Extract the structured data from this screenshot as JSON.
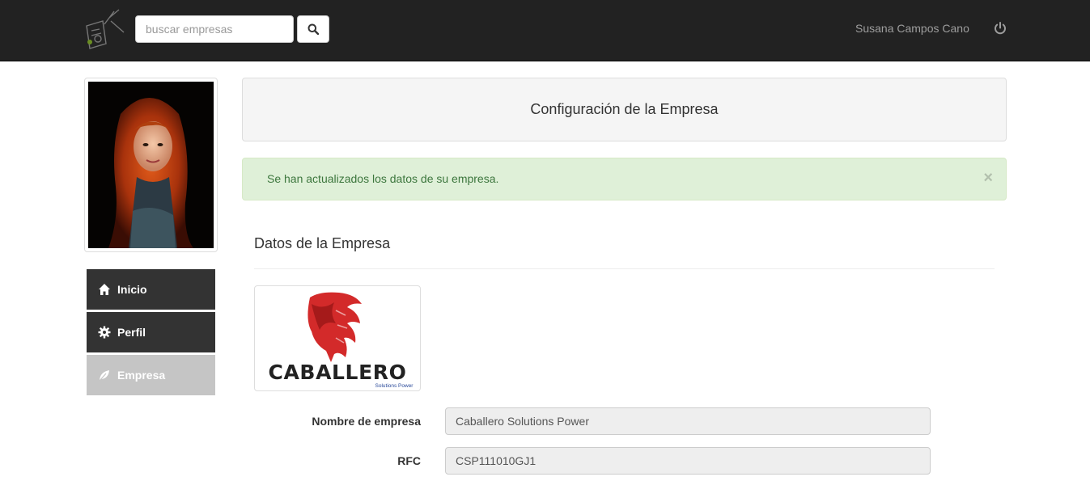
{
  "navbar": {
    "search": {
      "placeholder": "buscar empresas",
      "value": ""
    },
    "search_button_icon": "search-icon",
    "user_name": "Susana Campos Cano",
    "logout_icon": "power-icon"
  },
  "sidebar": {
    "items": [
      {
        "label": "Inicio",
        "icon": "home-icon",
        "active": false
      },
      {
        "label": "Perfil",
        "icon": "gear-icon",
        "active": false
      },
      {
        "label": "Empresa",
        "icon": "leaf-icon",
        "active": true
      }
    ]
  },
  "main": {
    "page_title": "Configuración de la Empresa",
    "alert": {
      "message": "Se han actualizados los datos de su empresa.",
      "close": "×"
    },
    "section_title": "Datos de la Empresa",
    "company_logo": {
      "brand": "CABALLERO",
      "tagline": "Solutions Power"
    },
    "form": {
      "name": {
        "label": "Nombre de empresa",
        "value": "Caballero Solutions Power"
      },
      "rfc": {
        "label": "RFC",
        "value": "CSP111010GJ1"
      }
    }
  },
  "colors": {
    "navbar_bg": "#222222",
    "menu_bg": "#333333",
    "menu_active_bg": "#c5c5c5",
    "alert_bg": "#dff0d8",
    "alert_text": "#3c763d",
    "brand_red": "#d32a2a"
  }
}
